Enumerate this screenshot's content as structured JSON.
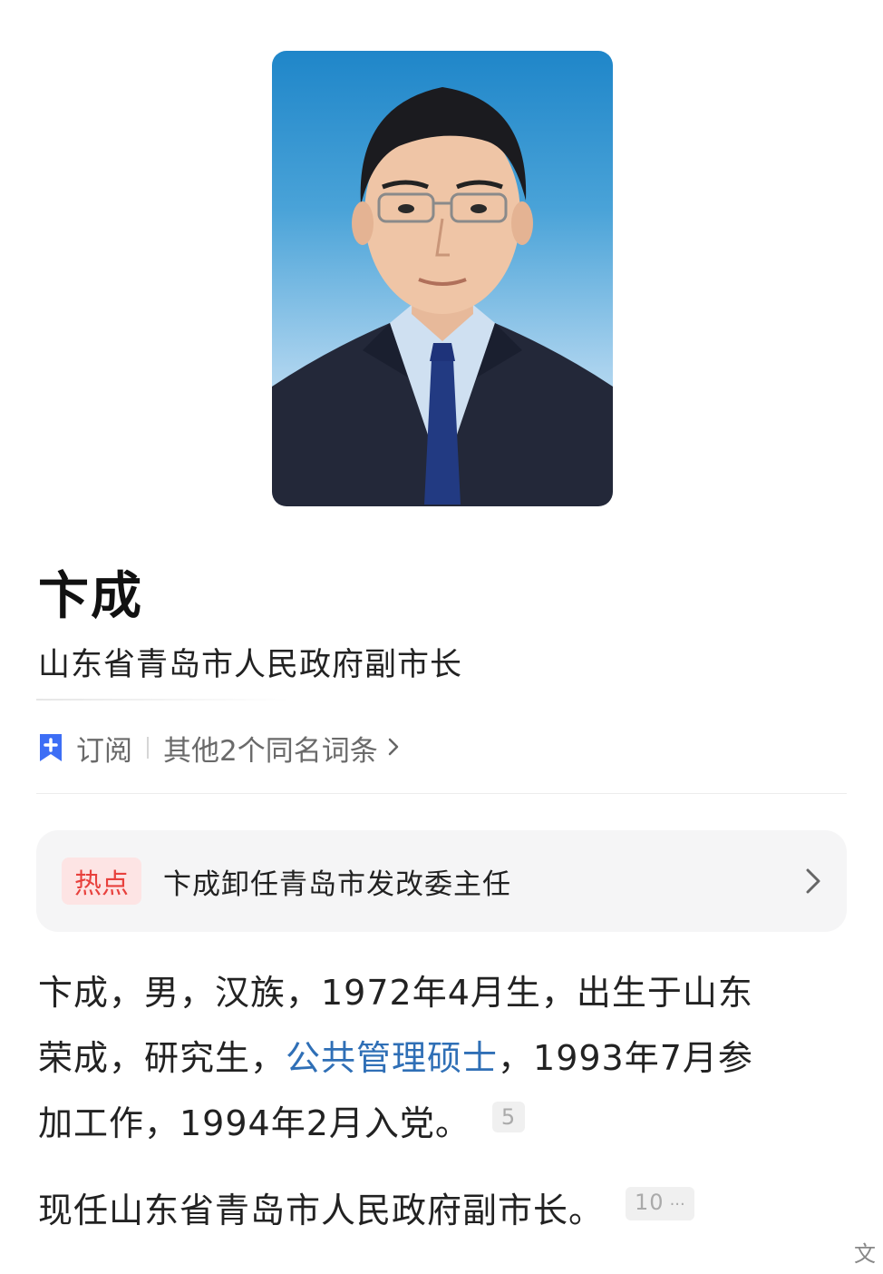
{
  "portrait": {
    "alt": "卞成"
  },
  "header": {
    "name": "卞成",
    "title": "山东省青岛市人民政府副市长"
  },
  "actions": {
    "subscribe": "订阅",
    "same_name": "其他2个同名词条"
  },
  "hot": {
    "badge": "热点",
    "text": "卞成卸任青岛市发改委主任"
  },
  "body": {
    "p1_line1": "卞成，男，汉族，1972年4月生，出生于山东",
    "p1_line2_a": "荣成，研究生，",
    "p1_link": "公共管理硕士",
    "p1_line2_b": "，1993年7月参",
    "p1_line3": "加工作，1994年2月入党。",
    "p1_ref": "5",
    "p2": "现任山东省青岛市人民政府副市长。",
    "p2_ref": "10",
    "p2_ref_more": "···",
    "cut_char": "文"
  },
  "colors": {
    "link": "#2f6fb6",
    "hot_badge_bg": "#fde4e4",
    "hot_badge_text": "#e8413d",
    "bookmark": "#3d6ef5"
  },
  "icons": {
    "bookmark": "bookmark-plus-icon",
    "chevron": "chevron-right-icon"
  }
}
